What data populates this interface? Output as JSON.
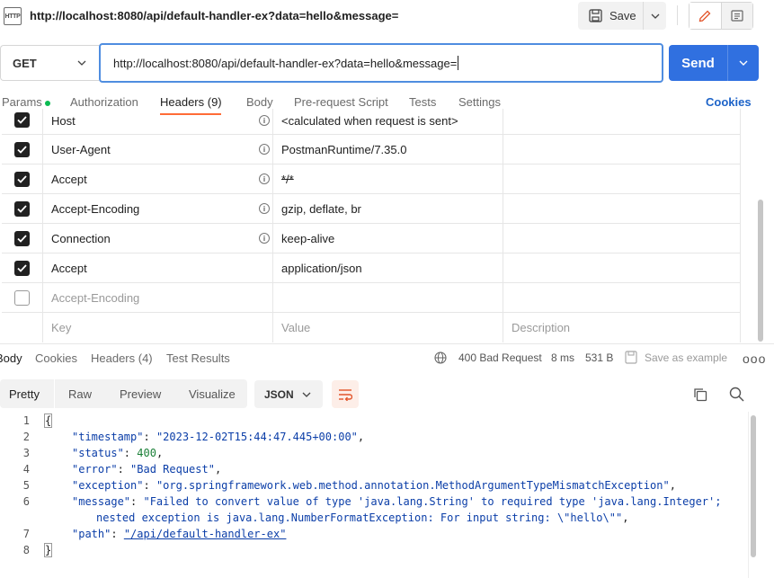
{
  "topbar": {
    "icon_text": "HTTP",
    "request_name": "http://localhost:8080/api/default-handler-ex?data=hello&message=",
    "save_label": "Save"
  },
  "urlbar": {
    "method": "GET",
    "url": "http://localhost:8080/api/default-handler-ex?data=hello&message=",
    "send_label": "Send"
  },
  "request_tabs": {
    "params": "Params",
    "authorization": "Authorization",
    "headers": "Headers (9)",
    "body": "Body",
    "prerequest": "Pre-request Script",
    "tests": "Tests",
    "settings": "Settings",
    "cookies": "Cookies"
  },
  "headers_table": {
    "rows": [
      {
        "key": "Host",
        "value": "<calculated when request is sent>",
        "checked": true
      },
      {
        "key": "User-Agent",
        "value": "PostmanRuntime/7.35.0",
        "checked": true
      },
      {
        "key": "Accept",
        "value": "*/*",
        "checked": true
      },
      {
        "key": "Accept-Encoding",
        "value": "gzip, deflate, br",
        "checked": true
      },
      {
        "key": "Connection",
        "value": "keep-alive",
        "checked": true
      },
      {
        "key": "Accept",
        "value": "application/json",
        "checked": true
      },
      {
        "key": "Accept-Encoding",
        "value": "",
        "checked": false
      }
    ],
    "placeholder": {
      "key": "Key",
      "value": "Value",
      "description": "Description"
    }
  },
  "response": {
    "tabs": {
      "body": "Body",
      "cookies": "Cookies",
      "headers": "Headers (4)",
      "tests": "Test Results"
    },
    "status": "400 Bad Request",
    "time": "8 ms",
    "size": "531 B",
    "save_example": "Save as example",
    "more": "ooo"
  },
  "viewer": {
    "pretty": "Pretty",
    "raw": "Raw",
    "preview": "Preview",
    "visualize": "Visualize",
    "format": "JSON"
  },
  "code": {
    "line_numbers": [
      "1",
      "2",
      "3",
      "4",
      "5",
      "6",
      "",
      "7",
      "8"
    ],
    "open_brace": "{",
    "close_brace": "}",
    "timestamp_key": "\"timestamp\"",
    "timestamp_val": "\"2023-12-02T15:44:47.445+00:00\"",
    "status_key": "\"status\"",
    "status_val": "400",
    "error_key": "\"error\"",
    "error_val": "\"Bad Request\"",
    "exception_key": "\"exception\"",
    "exception_val": "\"org.springframework.web.method.annotation.MethodArgumentTypeMismatchException\"",
    "message_key": "\"message\"",
    "message_val_1": "\"Failed to convert value of type 'java.lang.String' to required type 'java.lang.Integer';",
    "message_val_2": "nested exception is java.lang.NumberFormatException: For input string: \\\"hello\\\"\"",
    "path_key": "\"path\"",
    "path_val": "\"/api/default-handler-ex\""
  }
}
